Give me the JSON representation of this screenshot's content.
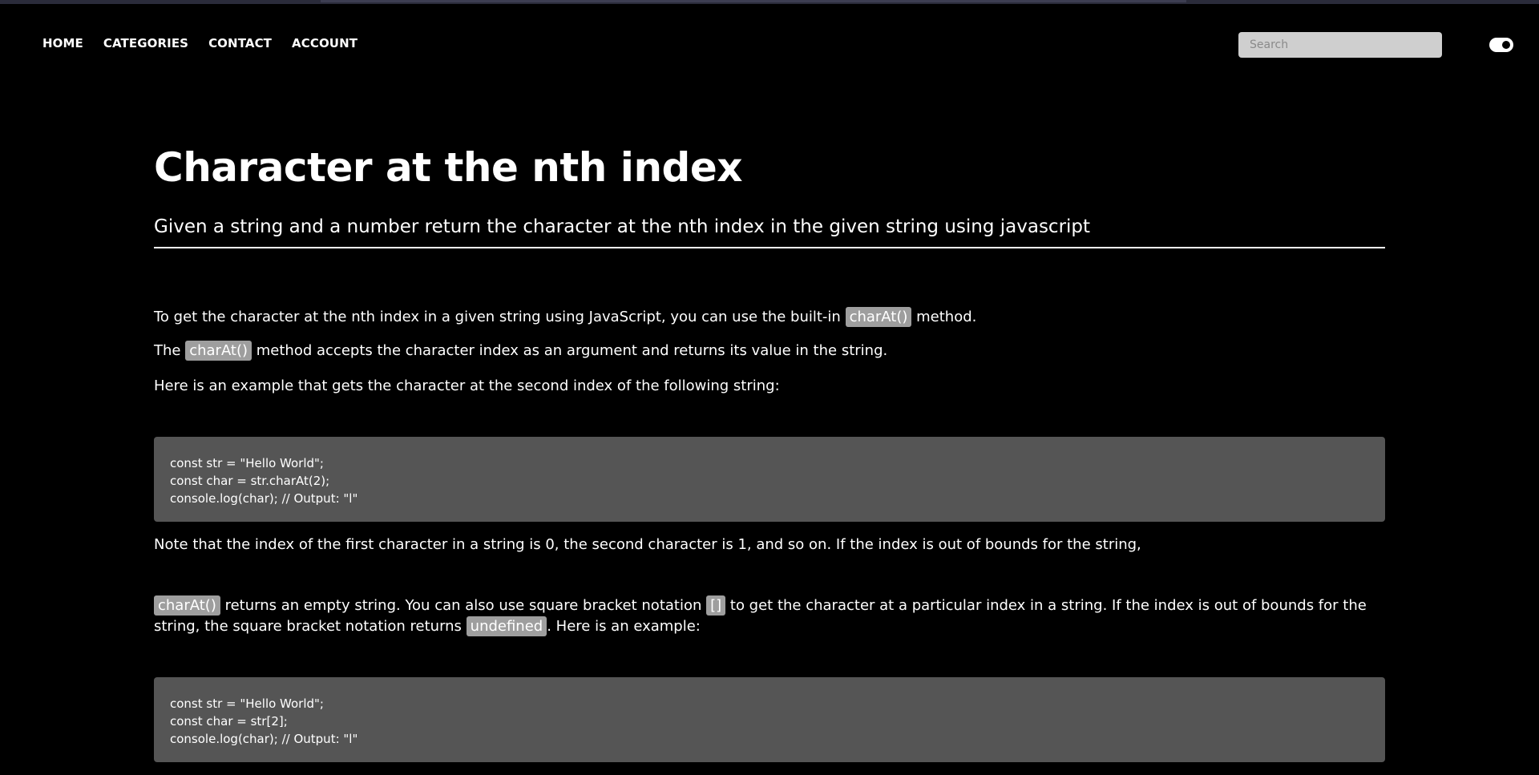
{
  "nav": {
    "links": [
      "HOME",
      "CATEGORIES",
      "CONTACT",
      "ACCOUNT"
    ],
    "search_placeholder": "Search",
    "theme_toggle": "toggle"
  },
  "article": {
    "title": "Character at the nth index",
    "subtitle": "Given a string and a number return the character at the nth index in the given string using javascript",
    "p1": {
      "before": "To get the character at the nth index in a given string using JavaScript, you can use the built-in ",
      "code": "charAt()",
      "after": " method."
    },
    "p2": {
      "before": "The ",
      "code": "charAt()",
      "after": " method accepts the character index as an argument and returns its value in the string."
    },
    "p3": "Here is an example that gets the character at the second index of the following string:",
    "code1": [
      "const str = \"Hello World\";",
      "const char = str.charAt(2);",
      "console.log(char); // Output: \"l\""
    ],
    "p4": "Note that the index of the first character in a string is 0, the second character is 1, and so on. If the index is out of bounds for the string,",
    "p5": {
      "code1": "charAt()",
      "text1": " returns an empty string. You can also use square bracket notation ",
      "code2": "[]",
      "text2": " to get the character at a particular index in a string. If the index is out of bounds for the string, the square bracket notation returns ",
      "code3": "undefined",
      "text3": ". Here is an example:"
    },
    "code2": [
      "const str = \"Hello World\";",
      "const char = str[2];",
      "console.log(char); // Output: \"l\""
    ]
  },
  "colors": {
    "background": "#000000",
    "text": "#ffffff",
    "inline_code_bg": "#9e9e9e",
    "code_block_bg": "#555555",
    "search_bg": "#cfcfcf"
  }
}
